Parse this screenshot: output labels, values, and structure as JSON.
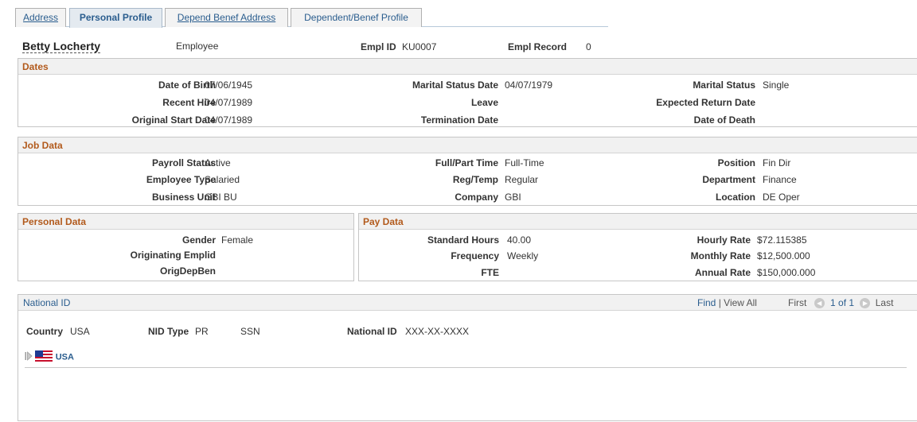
{
  "tabs": [
    {
      "label": "Address",
      "active": false
    },
    {
      "label": "Personal Profile",
      "active": true
    },
    {
      "label": "Depend Benef Address",
      "active": false
    },
    {
      "label": "Dependent/Benef Profile",
      "active": false
    }
  ],
  "header": {
    "name": "Betty Locherty",
    "role": "Employee",
    "emplid_label": "Empl ID",
    "emplid_value": "KU0007",
    "emplrec_label": "Empl Record",
    "emplrec_value": "0"
  },
  "dates": {
    "title": "Dates",
    "dob_label": "Date of Birth",
    "dob_value": "07/06/1945",
    "recent_hire_label": "Recent Hire",
    "recent_hire_value": "04/07/1989",
    "orig_start_label": "Original Start Date",
    "orig_start_value": "04/07/1989",
    "marital_date_label": "Marital Status Date",
    "marital_date_value": "04/07/1979",
    "leave_label": "Leave",
    "leave_value": "",
    "term_label": "Termination Date",
    "term_value": "",
    "marital_label": "Marital Status",
    "marital_value": "Single",
    "exp_return_label": "Expected Return Date",
    "exp_return_value": "",
    "death_label": "Date of Death",
    "death_value": ""
  },
  "job": {
    "title": "Job Data",
    "payroll_label": "Payroll Status",
    "payroll_value": "Active",
    "emptype_label": "Employee Type",
    "emptype_value": "Salaried",
    "bu_label": "Business Unit",
    "bu_value": "GBI BU",
    "fullpart_label": "Full/Part Time",
    "fullpart_value": "Full-Time",
    "regtemp_label": "Reg/Temp",
    "regtemp_value": "Regular",
    "company_label": "Company",
    "company_value": "GBI",
    "position_label": "Position",
    "position_value": "Fin Dir",
    "dept_label": "Department",
    "dept_value": "Finance",
    "location_label": "Location",
    "location_value": "DE Oper"
  },
  "personal": {
    "title": "Personal Data",
    "gender_label": "Gender",
    "gender_value": "Female",
    "orig_emplid_label": "Originating Emplid",
    "orig_emplid_value": "",
    "origdepben_label": "OrigDepBen",
    "origdepben_value": ""
  },
  "pay": {
    "title": "Pay Data",
    "std_hours_label": "Standard Hours",
    "std_hours_value": "40.00",
    "freq_label": "Frequency",
    "freq_value": "Weekly",
    "fte_label": "FTE",
    "fte_value": "",
    "hourly_label": "Hourly Rate",
    "hourly_value": "$72.115385",
    "monthly_label": "Monthly Rate",
    "monthly_value": "$12,500.000",
    "annual_label": "Annual Rate",
    "annual_value": "$150,000.000"
  },
  "national_id": {
    "title": "National ID",
    "find": "Find",
    "sep": "|",
    "view_all": "View All",
    "first": "First",
    "range": "1 of 1",
    "last": "Last",
    "country_label": "Country",
    "country_value": "USA",
    "nidtype_label": "NID Type",
    "nidtype_value1": "PR",
    "nidtype_value2": "SSN",
    "nid_label": "National ID",
    "nid_value": "XXX-XX-XXXX",
    "expand_country": "USA"
  },
  "colors": {
    "section_title": "#b25a1c",
    "link": "#2a5d8e",
    "section_header_bg": "#f1f1f1"
  }
}
